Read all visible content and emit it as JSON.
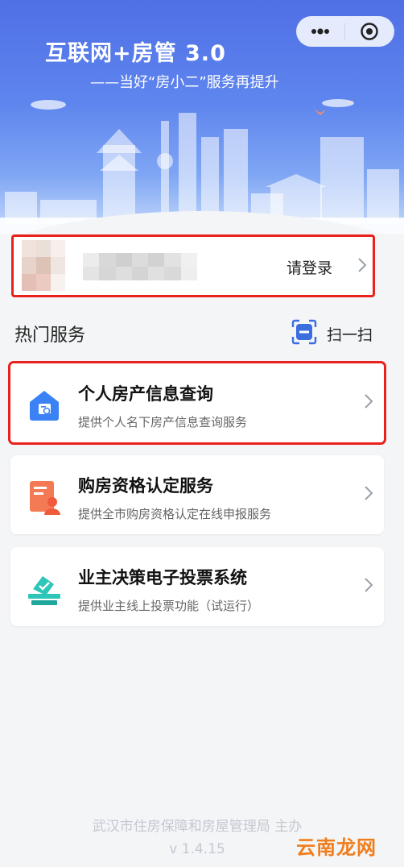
{
  "banner": {
    "title": "互联网+房管  3.0",
    "subtitle": "——当好“房小二”服务再提升"
  },
  "capsule": {
    "menu_icon": "more-dots-icon",
    "close_icon": "target-circle-icon"
  },
  "login": {
    "action_label": "请登录"
  },
  "hot_services": {
    "title": "热门服务",
    "scan_label": "扫一扫",
    "scan_icon": "scan-icon"
  },
  "services": [
    {
      "title": "个人房产信息查询",
      "description": "提供个人名下房产信息查询服务",
      "icon": "house-search-icon"
    },
    {
      "title": "购房资格认定服务",
      "description": "提供全市购房资格认定在线申报服务",
      "icon": "document-person-icon"
    },
    {
      "title": "业主决策电子投票系统",
      "description": "提供业主线上投票功能（试运行）",
      "icon": "ballot-box-icon"
    }
  ],
  "footer": {
    "organizer": "武汉市住房保障和房屋管理局 主办",
    "version": "v 1.4.15"
  },
  "watermark": "云南龙网",
  "colors": {
    "highlight": "#e8211d",
    "banner_blue": "#4f6fe6",
    "icon_blue": "#3b82f6",
    "icon_orange": "#f47a55",
    "icon_teal": "#2ec6b8"
  }
}
